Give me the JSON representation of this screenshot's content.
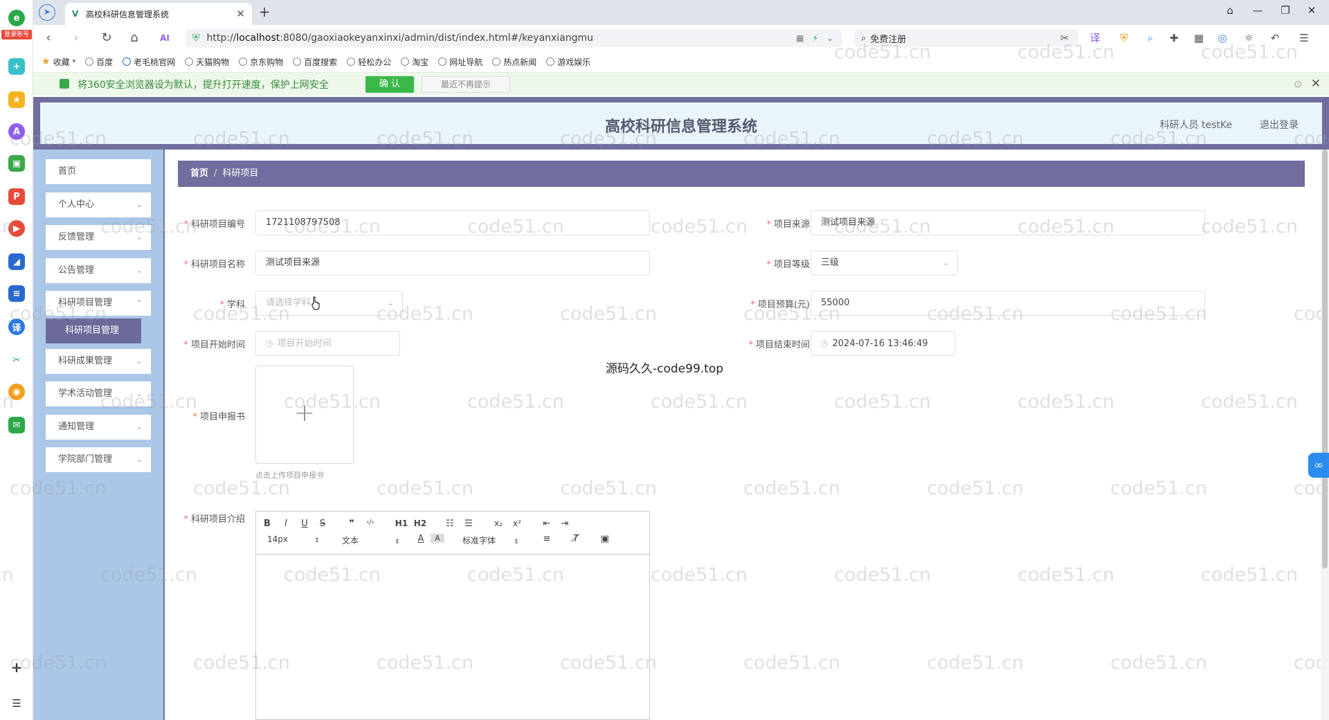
{
  "browser": {
    "tab_title": "高校科研信息管理系统",
    "url_scheme": "http://",
    "url_host": "localhost",
    "url_rest": ":8080/gaoxiaokeyanxinxi/admin/dist/index.html#/keyanxiangmu",
    "search_placeholder": "免费注册",
    "sidebar_badge": "登录账号",
    "bookmarks": [
      "收藏",
      "百度",
      "老毛桃官网",
      "天猫购物",
      "京东购物",
      "百度搜索",
      "轻松办公",
      "淘宝",
      "网址导航",
      "热点新闻",
      "游戏娱乐"
    ],
    "notice_text": "将360安全浏览器设为默认，提升打开速度，保护上网安全",
    "notice_confirm": "确 认",
    "notice_dismiss": "最近不再提示"
  },
  "header": {
    "title": "高校科研信息管理系统",
    "user_label": "科研人员 testKe",
    "logout": "退出登录"
  },
  "menu": {
    "items": [
      {
        "label": "首页"
      },
      {
        "label": "个人中心"
      },
      {
        "label": "反馈管理"
      },
      {
        "label": "公告管理"
      },
      {
        "label": "科研项目管理"
      },
      {
        "label": "科研项目管理"
      },
      {
        "label": "科研成果管理"
      },
      {
        "label": "学术活动管理"
      },
      {
        "label": "通知管理"
      },
      {
        "label": "学院部门管理"
      }
    ]
  },
  "breadcrumb": {
    "home": "首页",
    "sep": "/",
    "current": "科研项目"
  },
  "form": {
    "project_no": {
      "label": "科研项目编号",
      "value": "1721108797508"
    },
    "source": {
      "label": "项目来源",
      "value": "测试项目来源"
    },
    "name": {
      "label": "科研项目名称",
      "value": "测试项目来源"
    },
    "level": {
      "label": "项目等级",
      "value": "三级"
    },
    "subject": {
      "label": "学科",
      "placeholder": "请选择学科"
    },
    "budget": {
      "label": "项目预算(元)",
      "value": "55000"
    },
    "start": {
      "label": "项目开始时间",
      "placeholder": "项目开始时间"
    },
    "end": {
      "label": "项目结束时间",
      "value": "2024-07-16 13:46:49"
    },
    "proposal": {
      "label": "项目申报书",
      "tip": "点击上传项目申报书"
    },
    "intro": {
      "label": "科研项目介绍"
    }
  },
  "editor": {
    "font_size": "14px",
    "header_select": "文本",
    "font_family": "标准字体",
    "h1": "H1",
    "h2": "H2"
  },
  "overlay_text": "源码久久-code99.top",
  "watermark": "code51.cn"
}
